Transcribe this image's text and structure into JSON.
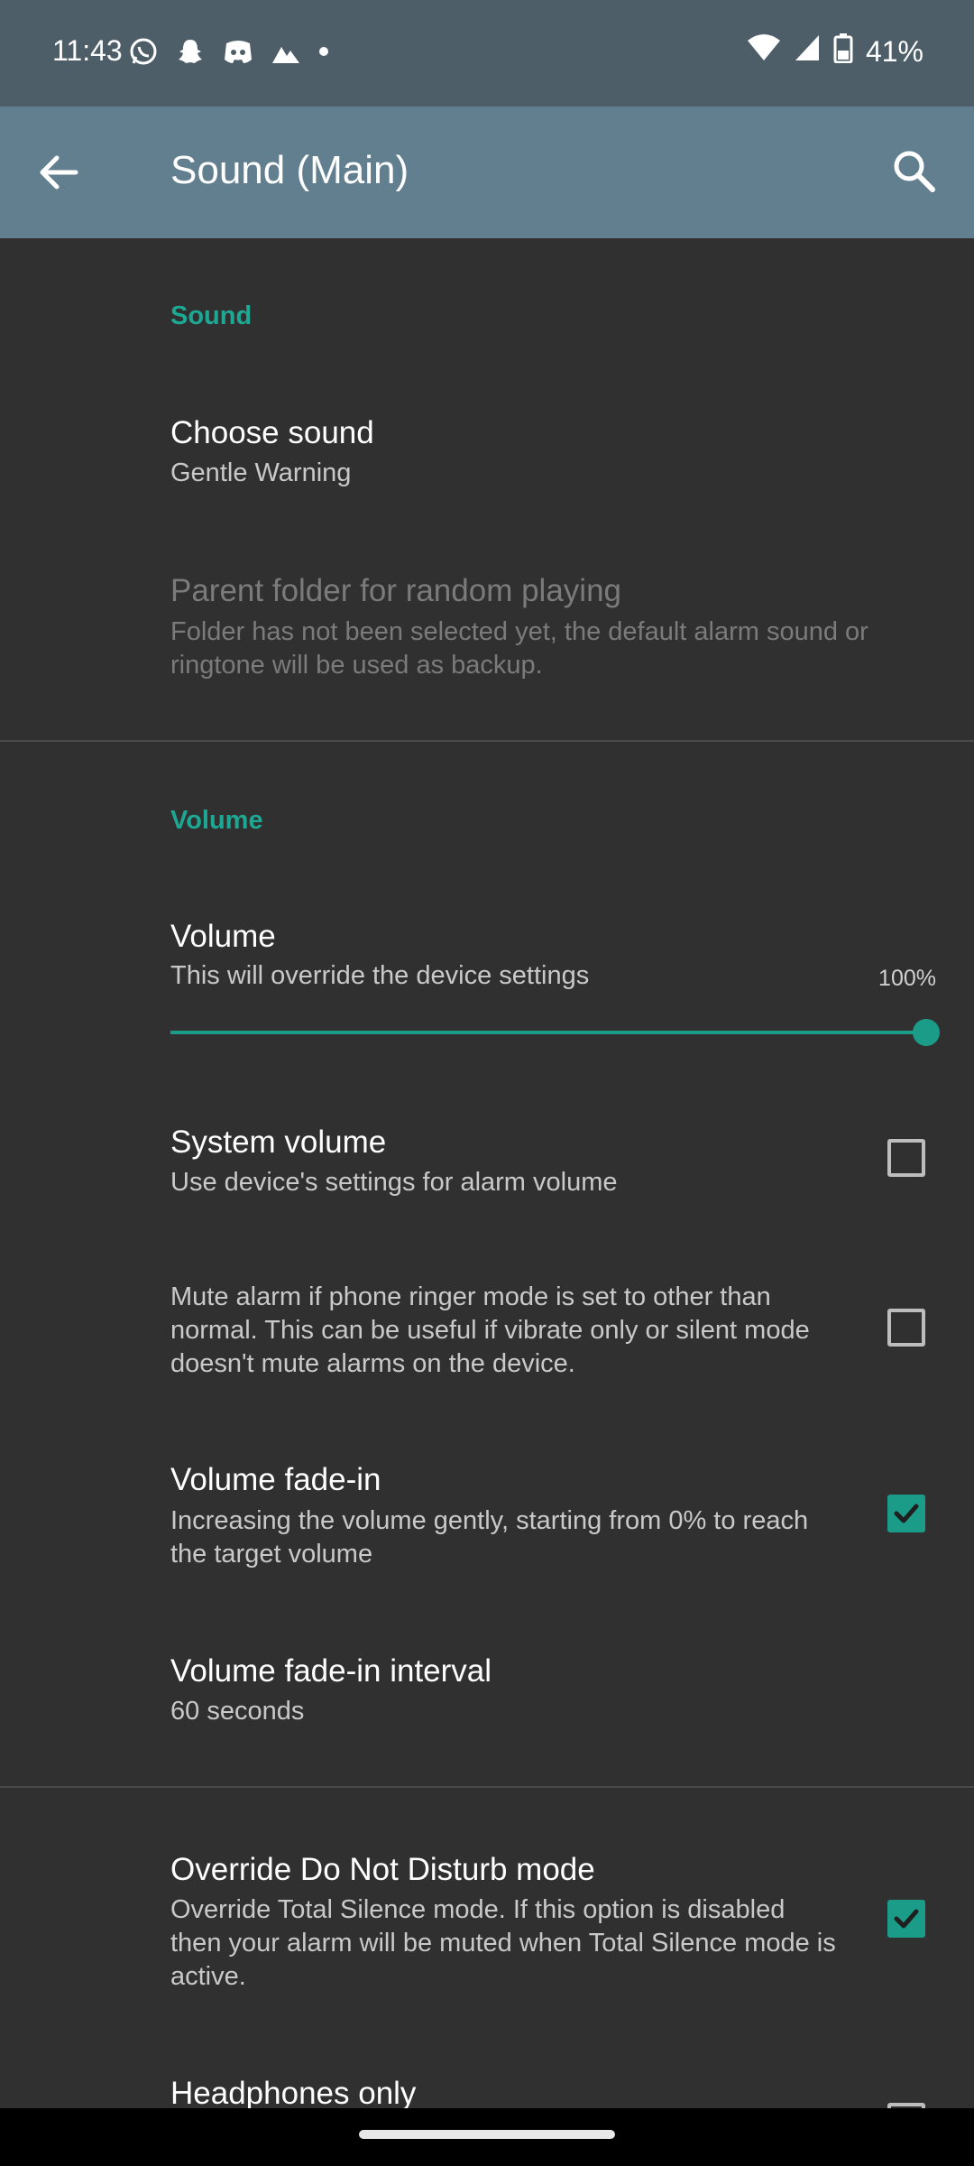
{
  "status_bar": {
    "time": "11:43",
    "battery": "41%",
    "notification_icons": [
      "whatsapp-icon",
      "snapchat-icon",
      "discord-icon",
      "app-icon",
      "dot-icon"
    ],
    "system_icons": [
      "wifi-icon",
      "signal-icon",
      "battery-icon"
    ]
  },
  "app_bar": {
    "title": "Sound (Main)",
    "back_icon": "arrow-left-icon",
    "search_icon": "search-icon"
  },
  "sections": {
    "sound": {
      "title": "Sound",
      "choose_sound": {
        "title": "Choose sound",
        "value": "Gentle Warning"
      },
      "parent_folder": {
        "title": "Parent folder for random playing",
        "subtitle": "Folder has not been selected yet, the default alarm sound or ringtone will be used as backup.",
        "enabled": false
      }
    },
    "volume": {
      "title": "Volume",
      "volume": {
        "title": "Volume",
        "subtitle": "This will override the device settings",
        "value_label": "100%",
        "value": 100
      },
      "system_volume": {
        "title": "System volume",
        "subtitle": "Use device's settings for alarm volume",
        "checked": false
      },
      "mute_ringer": {
        "subtitle": "Mute alarm if phone ringer mode is set to other than normal. This can be useful if vibrate only or silent mode doesn't mute alarms on the device.",
        "checked": false
      },
      "fade_in": {
        "title": "Volume fade-in",
        "subtitle": "Increasing the volume gently, starting from 0% to reach the target volume",
        "checked": true
      },
      "fade_in_interval": {
        "title": "Volume fade-in interval",
        "value": "60 seconds"
      }
    },
    "other": {
      "override_dnd": {
        "title": "Override Do Not Disturb mode",
        "subtitle": "Override Total Silence mode. If this option is disabled then your alarm will be muted when Total Silence mode is active.",
        "checked": true
      },
      "headphones_only": {
        "title": "Headphones only"
      }
    }
  },
  "colors": {
    "accent": "#1b9c88",
    "app_bar": "#627f8f",
    "status_bar": "#4d5e69",
    "background": "#303030"
  }
}
